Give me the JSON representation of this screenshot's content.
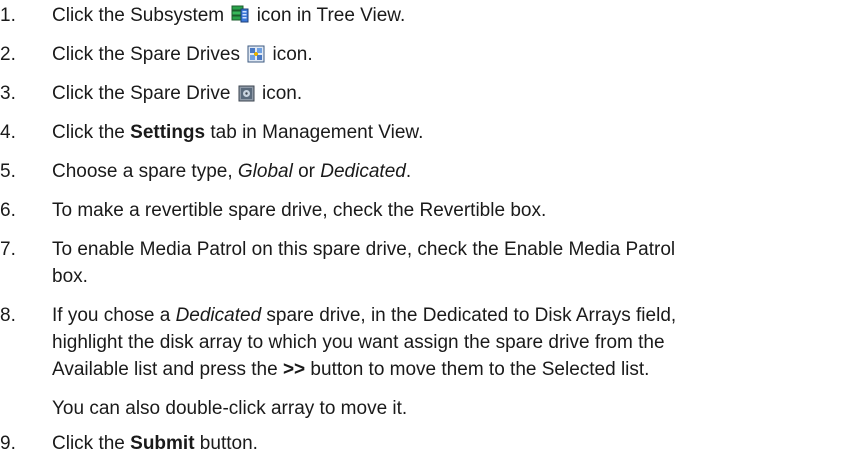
{
  "steps": [
    {
      "num": "1.",
      "a": "Click the Subsystem",
      "b": "icon in Tree View.",
      "icon": "subsystem-icon"
    },
    {
      "num": "2.",
      "a": "Click the Spare Drives",
      "b": "icon.",
      "icon": "spare-drives-icon"
    },
    {
      "num": "3.",
      "a": "Click the Spare Drive",
      "b": "icon.",
      "icon": "spare-drive-icon"
    },
    {
      "num": "4.",
      "a": "Click the ",
      "bold": "Settings",
      "b": " tab in Management View."
    },
    {
      "num": "5.",
      "a": "Choose a spare type, ",
      "it1": "Global",
      "mid": " or ",
      "it2": "Dedicated",
      "end": "."
    },
    {
      "num": "6.",
      "text": "To make a revertible spare drive, check the Revertible box."
    },
    {
      "num": "7.",
      "line1": "To enable Media Patrol on this spare drive, check the Enable Media Patrol",
      "line2": "box."
    },
    {
      "num": "8.",
      "l1a": "If you chose a ",
      "l1it": "Dedicated",
      "l1b": " spare drive, in the Dedicated to Disk Arrays field,",
      "line2": "highlight the disk array to which you want assign the spare drive from the",
      "l3a": "Available list and press the ",
      "l3bold": ">>",
      "l3b": " button to move them to the Selected list.",
      "note": "You can also double-click array to move it."
    },
    {
      "num": "9.",
      "a": "Click the ",
      "bold": "Submit",
      "b": " button."
    }
  ]
}
